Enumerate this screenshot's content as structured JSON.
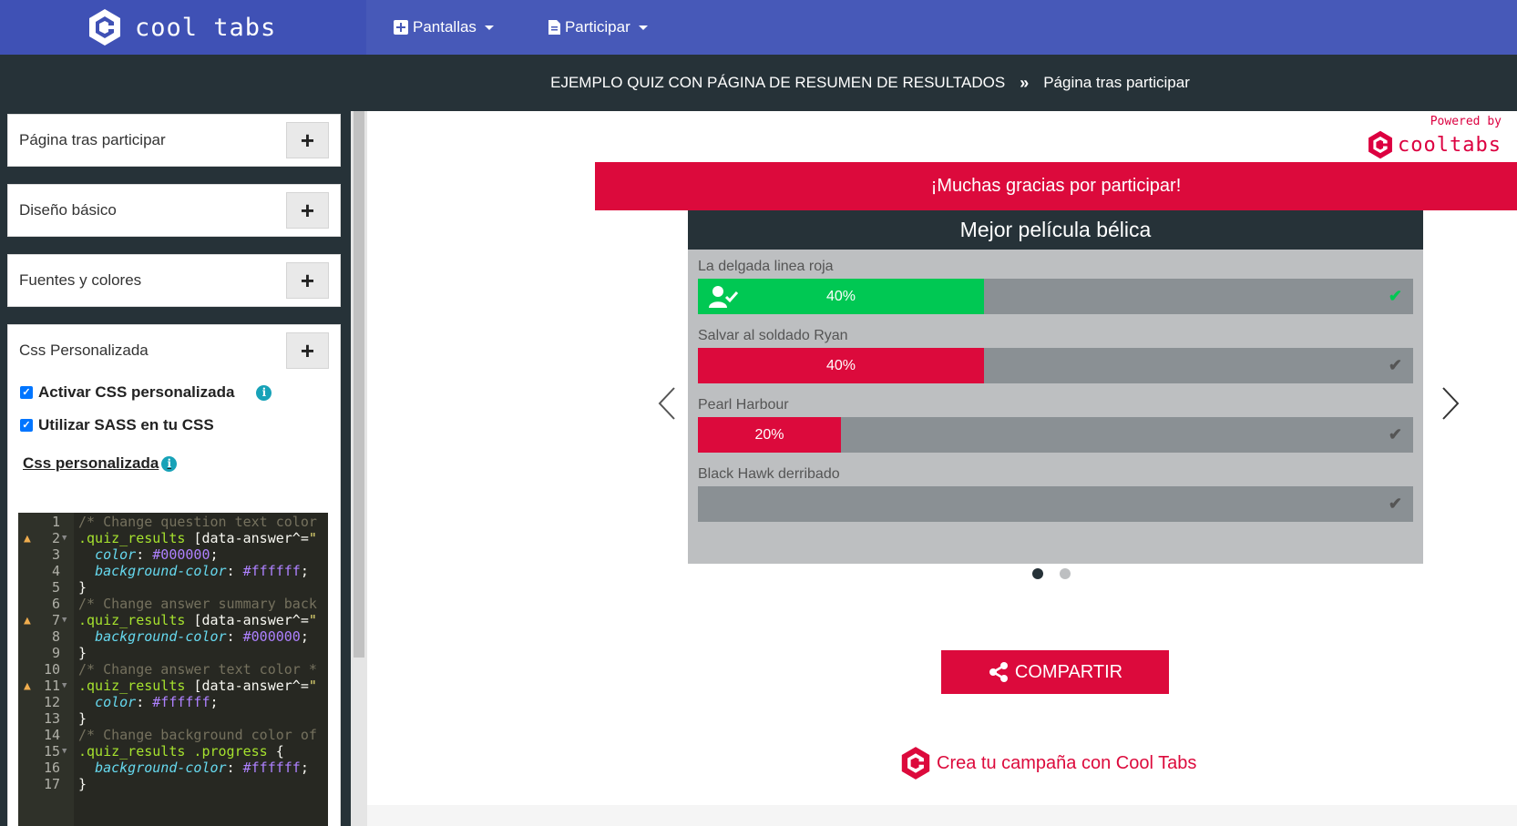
{
  "brand": {
    "name": "cool tabs"
  },
  "nav": {
    "items": [
      {
        "label": "Pantallas",
        "icon": "plus-square-icon"
      },
      {
        "label": "Participar",
        "icon": "file-icon"
      }
    ]
  },
  "breadcrumb": {
    "campaign": "EJEMPLO QUIZ CON PÁGINA DE RESUMEN DE RESULTADOS",
    "separator": "»",
    "page": "Página tras participar"
  },
  "sidebar": {
    "panels": [
      {
        "title": "Página tras participar",
        "button": "+"
      },
      {
        "title": "Diseño básico",
        "button": "+"
      },
      {
        "title": "Fuentes y colores",
        "button": "+"
      },
      {
        "title": "Css Personalizada",
        "button": "+"
      }
    ],
    "options": [
      {
        "label": "Activar CSS personalizada",
        "checked": true
      },
      {
        "label": "Utilizar SASS en tu CSS",
        "checked": true
      }
    ],
    "css_link": "Css personalizada",
    "info_glyph": "i"
  },
  "editor": {
    "lines": [
      {
        "n": "1",
        "text": "/* Change question text color",
        "warn": false,
        "fold": false
      },
      {
        "n": "2",
        "text": ".quiz_results [data-answer^=\"",
        "warn": true,
        "fold": true
      },
      {
        "n": "3",
        "text": "  color: #000000;",
        "warn": false,
        "fold": false
      },
      {
        "n": "4",
        "text": "  background-color: #ffffff;",
        "warn": false,
        "fold": false
      },
      {
        "n": "5",
        "text": "}",
        "warn": false,
        "fold": false
      },
      {
        "n": "6",
        "text": "/* Change answer summary back",
        "warn": false,
        "fold": false
      },
      {
        "n": "7",
        "text": ".quiz_results [data-answer^=\"",
        "warn": true,
        "fold": true
      },
      {
        "n": "8",
        "text": "  background-color: #000000;",
        "warn": false,
        "fold": false
      },
      {
        "n": "9",
        "text": "}",
        "warn": false,
        "fold": false
      },
      {
        "n": "10",
        "text": "/* Change answer text color *",
        "warn": false,
        "fold": false
      },
      {
        "n": "11",
        "text": ".quiz_results [data-answer^=\"",
        "warn": true,
        "fold": true
      },
      {
        "n": "12",
        "text": "  color: #ffffff;",
        "warn": false,
        "fold": false
      },
      {
        "n": "13",
        "text": "}",
        "warn": false,
        "fold": false
      },
      {
        "n": "14",
        "text": "/* Change background color of",
        "warn": false,
        "fold": false
      },
      {
        "n": "15",
        "text": ".quiz_results .progress {",
        "warn": false,
        "fold": true
      },
      {
        "n": "16",
        "text": "  background-color: #ffffff;",
        "warn": false,
        "fold": false
      },
      {
        "n": "17",
        "text": "}",
        "warn": false,
        "fold": false
      }
    ]
  },
  "preview": {
    "powered_by": "Powered by",
    "powered_brand": "cooltabs",
    "thanks": "¡Muchas gracias por participar!",
    "quiz": {
      "title": "Mejor película bélica",
      "answers": [
        {
          "label": "La delgada linea roja",
          "percent": 40,
          "percent_label": "40%",
          "color": "#00c853",
          "check_color": "#00c853",
          "selected": true
        },
        {
          "label": "Salvar al soldado Ryan",
          "percent": 40,
          "percent_label": "40%",
          "color": "#dc0a3c",
          "check_color": "#555555",
          "selected": false
        },
        {
          "label": "Pearl Harbour",
          "percent": 20,
          "percent_label": "20%",
          "color": "#dc0a3c",
          "check_color": "#555555",
          "selected": false
        },
        {
          "label": "Black Hawk derribado",
          "percent": 0,
          "percent_label": "",
          "color": "#dc0a3c",
          "check_color": "#555555",
          "selected": false
        }
      ]
    },
    "carousel": {
      "pages": 2,
      "active": 0
    },
    "share_label": "COMPARTIR",
    "create_label": "Crea tu campaña con Cool Tabs"
  },
  "colors": {
    "primary": "#3f51b5",
    "dark": "#263238",
    "accent": "#dc0a3c",
    "success": "#00c853"
  }
}
